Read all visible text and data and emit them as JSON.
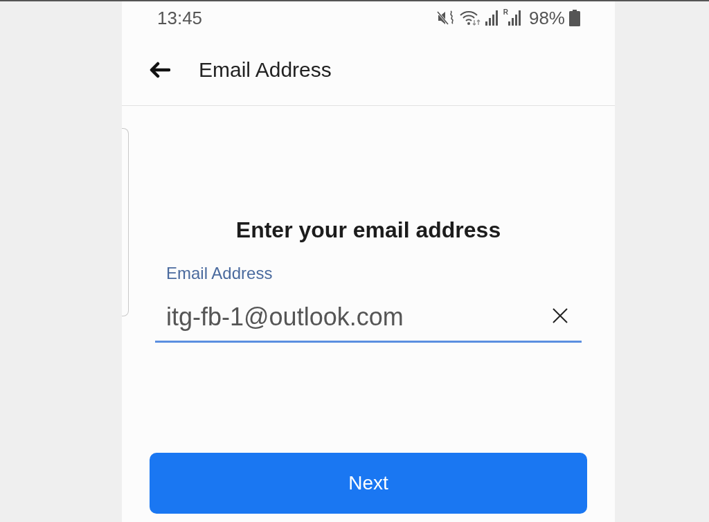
{
  "status_bar": {
    "time": "13:45",
    "roaming_label": "R",
    "battery": "98%"
  },
  "header": {
    "title": "Email Address"
  },
  "form": {
    "heading": "Enter your email address",
    "email_field": {
      "label": "Email Address",
      "value": "itg-fb-1@outlook.com"
    }
  },
  "buttons": [
    "Next"
  ]
}
